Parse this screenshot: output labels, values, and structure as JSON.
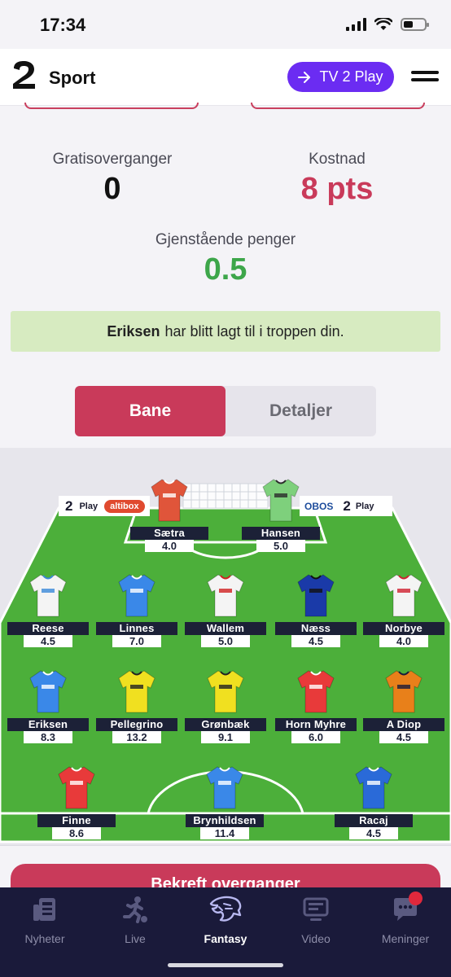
{
  "status": {
    "time": "17:34"
  },
  "header": {
    "brand": "Sport",
    "tv2play_label": "TV 2 Play"
  },
  "transfers": {
    "free_label": "Gratisoverganger",
    "free_value": "0",
    "cost_label": "Kostnad",
    "cost_value": "8 pts",
    "money_label": "Gjenstående penger",
    "money_value": "0.5"
  },
  "notice": {
    "player": "Eriksen",
    "text": "har blitt lagt til i troppen din."
  },
  "view_toggle": {
    "active": "Bane",
    "inactive": "Detaljer"
  },
  "pitch": {
    "ads": {
      "left_play": "Play",
      "altibox": "altibox",
      "obos": "OBOS",
      "right_play": "Play"
    },
    "goalkeepers": [
      {
        "name": "Sætra",
        "price": "4.0",
        "color": "#e0553a",
        "trim": "#ffffff"
      },
      {
        "name": "Hansen",
        "price": "5.0",
        "color": "#7ed07c",
        "trim": "#2a2a2a"
      }
    ],
    "defenders": [
      {
        "name": "Reese",
        "price": "4.5",
        "color": "#f4f4f4",
        "trim": "#3a88d8"
      },
      {
        "name": "Linnes",
        "price": "7.0",
        "color": "#3a88e8",
        "trim": "#ffffff"
      },
      {
        "name": "Wallem",
        "price": "5.0",
        "color": "#f4f4f4",
        "trim": "#d02020"
      },
      {
        "name": "Næss",
        "price": "4.5",
        "color": "#1a3aa8",
        "trim": "#111111"
      },
      {
        "name": "Norbye",
        "price": "4.0",
        "color": "#f4f4f4",
        "trim": "#d02030"
      }
    ],
    "midfielders": [
      {
        "name": "Eriksen",
        "price": "8.3",
        "color": "#3a88e8",
        "trim": "#ffffff"
      },
      {
        "name": "Pellegrino",
        "price": "13.2",
        "color": "#f0e020",
        "trim": "#222222"
      },
      {
        "name": "Grønbæk",
        "price": "9.1",
        "color": "#f0e020",
        "trim": "#222222"
      },
      {
        "name": "Horn Myhre",
        "price": "6.0",
        "color": "#e83a3a",
        "trim": "#ffffff"
      },
      {
        "name": "A Diop",
        "price": "4.5",
        "color": "#e8801a",
        "trim": "#1a1a3a"
      }
    ],
    "forwards": [
      {
        "name": "Finne",
        "price": "8.6",
        "color": "#e83a3a",
        "trim": "#ffffff"
      },
      {
        "name": "Brynhildsen",
        "price": "11.4",
        "color": "#3a88e8",
        "trim": "#ffffff"
      },
      {
        "name": "Racaj",
        "price": "4.5",
        "color": "#2a6ad8",
        "trim": "#ffffff"
      }
    ]
  },
  "confirm_label": "Bekreft overganger",
  "tabs": [
    {
      "label": "Nyheter",
      "icon": "news-icon"
    },
    {
      "label": "Live",
      "icon": "live-runner-icon"
    },
    {
      "label": "Fantasy",
      "icon": "fantasy-lion-icon"
    },
    {
      "label": "Video",
      "icon": "video-icon"
    },
    {
      "label": "Meninger",
      "icon": "opinions-icon"
    }
  ],
  "colors": {
    "accent": "#c93a5a",
    "purple": "#6b2cf2",
    "money": "#3da64a",
    "pitch": "#4caf3a",
    "navy": "#1a1a3a"
  }
}
